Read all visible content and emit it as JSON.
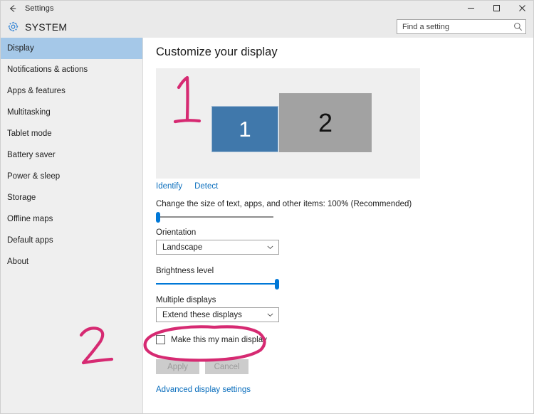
{
  "window": {
    "title": "Settings",
    "back_icon": "back-arrow-icon",
    "minimize_label": "—",
    "maximize_label": "□",
    "close_label": "✕"
  },
  "header": {
    "icon": "gear-icon",
    "title": "SYSTEM"
  },
  "search": {
    "placeholder": "Find a setting",
    "value": "",
    "icon": "search-icon"
  },
  "sidebar": {
    "items": [
      {
        "label": "Display",
        "selected": true
      },
      {
        "label": "Notifications & actions",
        "selected": false
      },
      {
        "label": "Apps & features",
        "selected": false
      },
      {
        "label": "Multitasking",
        "selected": false
      },
      {
        "label": "Tablet mode",
        "selected": false
      },
      {
        "label": "Battery saver",
        "selected": false
      },
      {
        "label": "Power & sleep",
        "selected": false
      },
      {
        "label": "Storage",
        "selected": false
      },
      {
        "label": "Offline maps",
        "selected": false
      },
      {
        "label": "Default apps",
        "selected": false
      },
      {
        "label": "About",
        "selected": false
      }
    ]
  },
  "main": {
    "page_title": "Customize your display",
    "preview": {
      "monitors": [
        {
          "number": "1",
          "selected": true,
          "color": "#4078ab"
        },
        {
          "number": "2",
          "selected": false,
          "color": "#a2a2a2"
        }
      ]
    },
    "identify_link": "Identify",
    "detect_link": "Detect",
    "scale_label": "Change the size of text, apps, and other items: 100% (Recommended)",
    "scale_value": 0,
    "orientation_label": "Orientation",
    "orientation_value": "Landscape",
    "brightness_label": "Brightness level",
    "brightness_value": 100,
    "multiple_displays_label": "Multiple displays",
    "multiple_displays_value": "Extend these displays",
    "main_display_checkbox_label": "Make this my main display",
    "main_display_checked": false,
    "apply_label": "Apply",
    "cancel_label": "Cancel",
    "apply_enabled": false,
    "cancel_enabled": false,
    "advanced_link": "Advanced display settings"
  },
  "annotations": {
    "color": "#d62a72",
    "marks": [
      {
        "name": "handwritten-number-1",
        "text": "1"
      },
      {
        "name": "handwritten-number-2",
        "text": "2"
      },
      {
        "name": "handwritten-circle",
        "text": ""
      }
    ]
  }
}
